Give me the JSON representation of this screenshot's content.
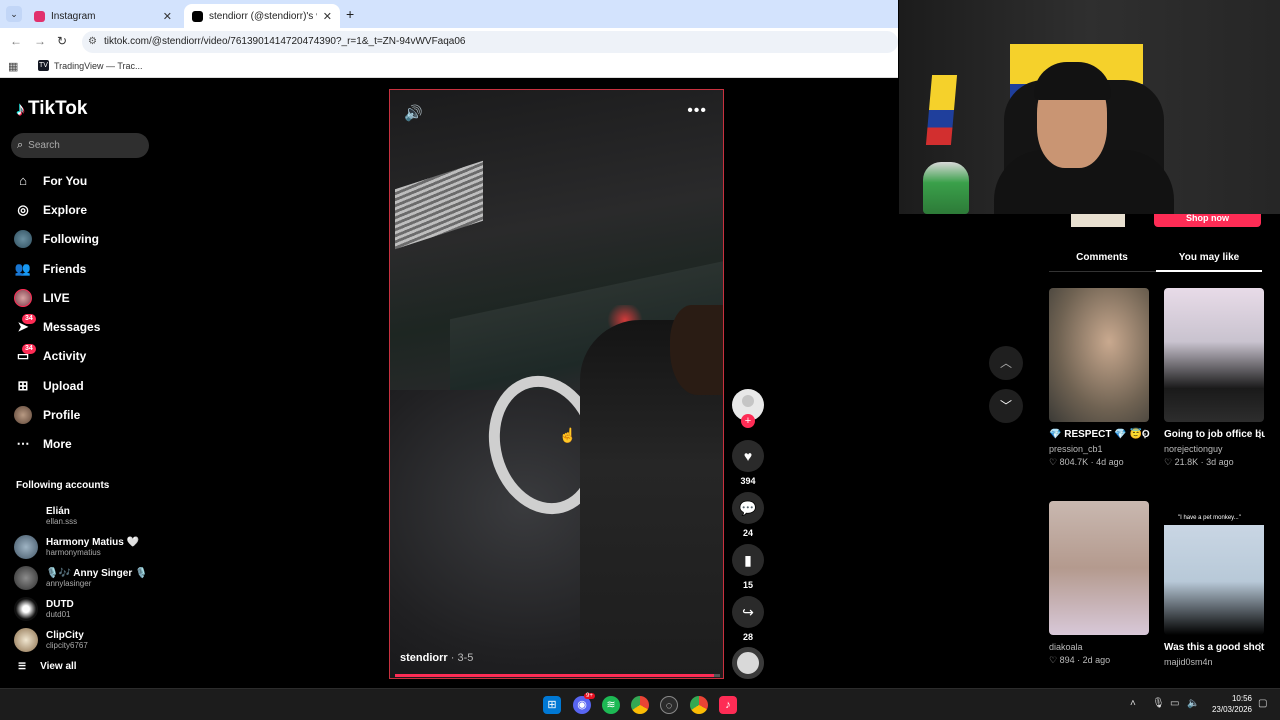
{
  "browser": {
    "tabs": [
      {
        "label": "Instagram",
        "active": false,
        "favicon_color": "#e1306c"
      },
      {
        "label": "stendiorr (@stendiorr)'s videos",
        "active": true,
        "favicon_color": "#000000"
      }
    ],
    "url": "tiktok.com/@stendiorr/video/7613901414720474390?_r=1&_t=ZN-94vWVFaqa06",
    "bookmarks": [
      {
        "label": "TradingView — Trac..."
      }
    ]
  },
  "sidebar": {
    "logo": "TikTok",
    "search_placeholder": "Search",
    "nav": [
      {
        "label": "For You",
        "icon": "home-icon"
      },
      {
        "label": "Explore",
        "icon": "compass-icon"
      },
      {
        "label": "Following",
        "icon": "avatar"
      },
      {
        "label": "Friends",
        "icon": "friends-icon"
      },
      {
        "label": "LIVE",
        "icon": "avatar"
      },
      {
        "label": "Messages",
        "icon": "send-icon",
        "badge": "34"
      },
      {
        "label": "Activity",
        "icon": "inbox-icon",
        "badge": "34"
      },
      {
        "label": "Upload",
        "icon": "plus-square-icon"
      },
      {
        "label": "Profile",
        "icon": "avatar"
      },
      {
        "label": "More",
        "icon": "more-dots-icon"
      }
    ],
    "following_title": "Following accounts",
    "following": [
      {
        "name": "Elián",
        "username": "ellan.sss"
      },
      {
        "name": "Harmony Matius 🤍",
        "username": "harmonymatius"
      },
      {
        "name": "🎙️🎶 Anny Singer 🎙️",
        "username": "annylasinger"
      },
      {
        "name": "DUTD",
        "username": "dutd01"
      },
      {
        "name": "ClipCity",
        "username": "clipcity6767"
      }
    ],
    "view_all": "View all"
  },
  "video": {
    "author": "stendiorr",
    "date": " · 3-5",
    "progress": 0.98
  },
  "actions": {
    "likes": "394",
    "comments": "24",
    "saves": "15",
    "shares": "28"
  },
  "right_panel": {
    "shop_now": "Shop now",
    "tabs": [
      "Comments",
      "You may like"
    ],
    "active_tab": "You may like",
    "cards": [
      {
        "title": "💎 RESPECT 💎 😇Only for the...",
        "user": "pression_cb1",
        "likes": "804.7K",
        "age": "4d ago"
      },
      {
        "title": "Going to job office but coming with...",
        "user": "norejectionguy",
        "likes": "21.8K",
        "age": "3d ago"
      },
      {
        "title": "",
        "user": "diakoala",
        "likes": "894",
        "age": "2d ago"
      },
      {
        "title": "Was this a good shot? 💔 Twitch:...",
        "user": "majid0sm4n",
        "likes": "",
        "age": ""
      }
    ],
    "card4_caption": "\"I have a pet monkey...\""
  },
  "taskbar": {
    "time": "10:56",
    "date": "23/03/2026",
    "discord_badge": "9+"
  },
  "colors": {
    "accent": "#fe2c55",
    "background": "#000000"
  }
}
